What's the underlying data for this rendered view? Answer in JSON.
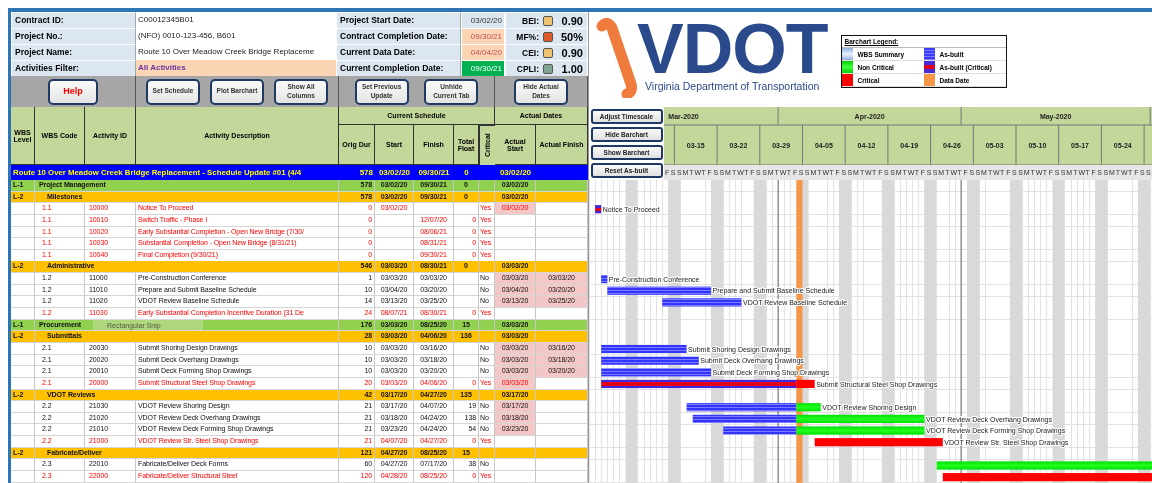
{
  "info_rows": [
    {
      "label": "Contract ID:",
      "value": {
        "text": "C00012345B01",
        "kind": "text"
      },
      "date_label": "Project Start Date:",
      "date": {
        "text": "03/02/20",
        "kind": "plain"
      },
      "metric": "BEI:",
      "metric_value": "0.90",
      "color": "#f2c46d"
    },
    {
      "label": "Project No.:",
      "value": {
        "text": "(NFO) 0010-123-456, B601",
        "kind": "text"
      },
      "date_label": "Contract Completion Date:",
      "date": {
        "text": "09/30/21",
        "kind": "flag"
      },
      "metric": "MF%:",
      "metric_value": "50%",
      "color": "#e0592a"
    },
    {
      "label": "Project Name:",
      "value": {
        "text": "Route 10 Over Meadow Creek Bridge Replaceme",
        "kind": "text"
      },
      "date_label": "Current Data Date:",
      "date": {
        "text": "04/04/20",
        "kind": "flag"
      },
      "metric": "CEI:",
      "metric_value": "0.90",
      "color": "#f2c46d"
    },
    {
      "label": "Activities Filter:",
      "value": {
        "text": "All Activities",
        "kind": "filter"
      },
      "date_label": "Current Completion Date:",
      "date": {
        "text": "09/30/21",
        "kind": "good"
      },
      "metric": "CPLI:",
      "metric_value": "1.00",
      "color": "#7fa58e"
    }
  ],
  "toolbar": [
    [
      {
        "label": "Help",
        "kind": "help"
      }
    ],
    [
      {
        "label": "Set Schedule",
        "kind": "normal"
      },
      {
        "label": "Plot Barchart",
        "kind": "normal"
      },
      {
        "label": "Show All Columns",
        "kind": "normal"
      }
    ],
    [
      {
        "label": "Set Previous Update",
        "kind": "normal"
      },
      {
        "label": "Unhide Current Tab",
        "kind": "normal"
      }
    ],
    [
      {
        "label": "Hide Actual Dates",
        "kind": "normal"
      }
    ]
  ],
  "header": {
    "columns": [
      "WBS Level",
      "WBS Code",
      "Activity ID",
      "Activity Description",
      "Orig Dur",
      "Start",
      "Finish",
      "Total Float",
      "Critical",
      "Actual Start",
      "Actual Finish"
    ],
    "groups": [
      "Current Schedule",
      "Actual Dates"
    ]
  },
  "title_row": {
    "text": "Route 10 Over Meadow Creek Bridge Replacement - Schedule Update #01 (4/4",
    "orig_dur": "578",
    "start": "03/02/20",
    "finish": "09/30/21",
    "total_float": "0",
    "actual_start": "03/02/20"
  },
  "rows": [
    {
      "kind": "l1",
      "level": "L-1",
      "name": "Project Management",
      "orig_dur": "578",
      "start": "03/02/20",
      "finish": "09/30/21",
      "total_float": "0",
      "actual_start": "03/02/20"
    },
    {
      "kind": "l2",
      "level": "L-2",
      "name": "Milestones",
      "orig_dur": "578",
      "start": "03/02/20",
      "finish": "09/30/21",
      "total_float": "0",
      "actual_start": "03/02/20"
    },
    {
      "kind": "activity",
      "code": "1.1",
      "id": "10000",
      "description": "Notice To Proceed",
      "orig_dur": "0",
      "start": "03/02/20",
      "critical_text": "Yes",
      "critical": true,
      "actual_start": "03/02/20",
      "bar_label": "Notice To Proceed"
    },
    {
      "kind": "activity",
      "code": "1.1",
      "id": "10010",
      "description": "Switch Traffic - Phase I",
      "orig_dur": "0",
      "finish": "12/07/20",
      "total_float": "0",
      "critical_text": "Yes",
      "critical": true
    },
    {
      "kind": "activity",
      "code": "1.1",
      "id": "10020",
      "description": "Early Substantial Completion - Open New Bridge (7/30/",
      "orig_dur": "0",
      "finish": "08/06/21",
      "total_float": "0",
      "critical_text": "Yes",
      "critical": true
    },
    {
      "kind": "activity",
      "code": "1.1",
      "id": "10030",
      "description": "Substantial Completion - Open New Bridge (8/31/21)",
      "orig_dur": "0",
      "finish": "08/31/21",
      "total_float": "0",
      "critical_text": "Yes",
      "critical": true
    },
    {
      "kind": "activity",
      "code": "1.1",
      "id": "10040",
      "description": "Final Completion (9/30/21)",
      "orig_dur": "0",
      "finish": "09/30/21",
      "total_float": "0",
      "critical_text": "Yes",
      "critical": true
    },
    {
      "kind": "l2",
      "level": "L-2",
      "name": "Administrative",
      "orig_dur": "546",
      "start": "03/03/20",
      "finish": "08/30/21",
      "total_float": "0",
      "actual_start": "03/03/20"
    },
    {
      "kind": "activity",
      "code": "1.2",
      "id": "11000",
      "description": "Pre-Construction Conference",
      "orig_dur": "1",
      "start": "03/03/20",
      "finish": "03/03/20",
      "critical_text": "No",
      "critical": false,
      "actual_start": "03/03/20",
      "actual_finish": "03/03/20",
      "bar_label": "Pre-Construction Conference"
    },
    {
      "kind": "activity",
      "code": "1.2",
      "id": "11010",
      "description": "Prepare and Submit Baseline Schedule",
      "orig_dur": "10",
      "start": "03/04/20",
      "finish": "03/20/20",
      "critical_text": "No",
      "critical": false,
      "actual_start": "03/04/20",
      "actual_finish": "03/20/20",
      "bar_label": "Prepare and Submit Baseline Schedule"
    },
    {
      "kind": "activity",
      "code": "1.2",
      "id": "11020",
      "description": "VDOT Review Baseline Schedule",
      "orig_dur": "14",
      "start": "03/13/20",
      "finish": "03/25/20",
      "critical_text": "No",
      "critical": false,
      "actual_start": "03/13/20",
      "actual_finish": "03/25/20",
      "bar_label": "VDOT Review Baseline Schedule"
    },
    {
      "kind": "activity",
      "code": "1.2",
      "id": "11030",
      "description": "Early Substantial Completion Incentive Duration (31 De",
      "orig_dur": "24",
      "start": "08/07/21",
      "finish": "08/30/21",
      "total_float": "0",
      "critical_text": "Yes",
      "critical": true
    },
    {
      "kind": "l1",
      "level": "L-1",
      "name": "Procurement",
      "orig_dur": "176",
      "start": "03/03/20",
      "finish": "08/25/20",
      "total_float": "15",
      "actual_start": "03/03/20"
    },
    {
      "kind": "l2",
      "level": "L-2",
      "name": "Submittals",
      "orig_dur": "28",
      "start": "03/03/20",
      "finish": "04/06/20",
      "total_float": "136",
      "actual_start": "03/03/20"
    },
    {
      "kind": "activity",
      "code": "2.1",
      "id": "20030",
      "description": "Submit Shoring Design Drawings",
      "orig_dur": "10",
      "start": "03/03/20",
      "finish": "03/16/20",
      "critical_text": "No",
      "critical": false,
      "actual_start": "03/03/20",
      "actual_finish": "03/16/20",
      "bar_label": "Submit Shoring Design Drawings"
    },
    {
      "kind": "activity",
      "code": "2.1",
      "id": "20020",
      "description": "Submit Deck Overhang Drawings",
      "orig_dur": "10",
      "start": "03/03/20",
      "finish": "03/18/20",
      "critical_text": "No",
      "critical": false,
      "actual_start": "03/03/20",
      "actual_finish": "03/18/20",
      "bar_label": "Submit Deck Overhang Drawings"
    },
    {
      "kind": "activity",
      "code": "2.1",
      "id": "20010",
      "description": "Submit Deck Forming Shop Drawings",
      "orig_dur": "10",
      "start": "03/03/20",
      "finish": "03/20/20",
      "critical_text": "No",
      "critical": false,
      "actual_start": "03/03/20",
      "actual_finish": "03/20/20",
      "bar_label": "Submit Deck Forming Shop Drawings"
    },
    {
      "kind": "activity",
      "code": "2.1",
      "id": "20000",
      "description": "Submit Structural Steel Shop Drawings",
      "orig_dur": "20",
      "start": "03/03/20",
      "finish": "04/06/20",
      "total_float": "0",
      "critical_text": "Yes",
      "critical": true,
      "actual_start": "03/03/20",
      "bar_label": "Submit Structural Steel Shop Drawings"
    },
    {
      "kind": "l2",
      "level": "L-2",
      "name": "VDOT Reviews",
      "orig_dur": "42",
      "start": "03/17/20",
      "finish": "04/27/20",
      "total_float": "135",
      "actual_start": "03/17/20"
    },
    {
      "kind": "activity",
      "code": "2.2",
      "id": "21030",
      "description": "VDOT Review Shoring Design",
      "orig_dur": "21",
      "start": "03/17/20",
      "finish": "04/07/20",
      "total_float": "19",
      "critical_text": "No",
      "critical": false,
      "actual_start": "03/17/20",
      "bar_label": "VDOT Review Shoring Design"
    },
    {
      "kind": "activity",
      "code": "2.2",
      "id": "21020",
      "description": "VDOT Review Deck Overhang Drawings",
      "orig_dur": "21",
      "start": "03/18/20",
      "finish": "04/24/20",
      "total_float": "138",
      "critical_text": "No",
      "critical": false,
      "actual_start": "03/18/20",
      "bar_label": "VDOT Review Deck Overhang Drawings"
    },
    {
      "kind": "activity",
      "code": "2.2",
      "id": "21010",
      "description": "VDOT Review Deck Forming Shop Drawings",
      "orig_dur": "21",
      "start": "03/23/20",
      "finish": "04/24/20",
      "total_float": "54",
      "critical_text": "No",
      "critical": false,
      "actual_start": "03/23/20",
      "bar_label": "VDOT Review Deck Forming Shop Drawings"
    },
    {
      "kind": "activity",
      "code": "2.2",
      "id": "21000",
      "description": "VDOT Review Str. Steel Shop Drawings",
      "orig_dur": "21",
      "start": "04/07/20",
      "finish": "04/27/20",
      "total_float": "0",
      "critical_text": "Yes",
      "critical": true,
      "bar_label": "VDOT Review Str. Steel Shop Drawings"
    },
    {
      "kind": "l2",
      "level": "L-2",
      "name": "Fabricate/Deliver",
      "orig_dur": "121",
      "start": "04/27/20",
      "finish": "08/25/20",
      "total_float": "15"
    },
    {
      "kind": "activity",
      "code": "2.3",
      "id": "22010",
      "description": "Fabricate/Deliver Deck Forms",
      "orig_dur": "60",
      "start": "04/27/20",
      "finish": "07/17/20",
      "total_float": "38",
      "critical_text": "No",
      "critical": false
    },
    {
      "kind": "activity",
      "code": "2.3",
      "id": "22000",
      "description": "Fabricate/Deliver Structural Steel",
      "orig_dur": "120",
      "start": "04/28/20",
      "finish": "08/25/20",
      "total_float": "0",
      "critical_text": "Yes",
      "critical": true
    }
  ],
  "snip_tooltip": {
    "text": "Rectangular Snip"
  },
  "logo": {
    "text": "VDOT",
    "subtitle": "Virginia Department of Transportation"
  },
  "legend": {
    "title": "Barchart Legend:",
    "items": [
      {
        "label": "WBS Summary",
        "kind": "summary"
      },
      {
        "label": "As-built",
        "kind": "asbuilt"
      },
      {
        "label": "Non Critical",
        "kind": "noncritical"
      },
      {
        "label": "As-built (Critical)",
        "kind": "asbuilt-critical"
      },
      {
        "label": "Critical",
        "kind": "critical"
      },
      {
        "label": "Data Date",
        "kind": "datadate"
      }
    ]
  },
  "gantt_buttons": [
    "Adjust Timescale",
    "Hide Barchart",
    "Show Barchart",
    "Reset As-built"
  ],
  "timeline": {
    "months": [
      "Mar-2020",
      "Apr-2020",
      "May-2020"
    ],
    "weeks": [
      "03-15",
      "03-22",
      "03-29",
      "04-05",
      "04-12",
      "04-19",
      "04-26",
      "05-03",
      "05-10",
      "05-17",
      "05-24"
    ],
    "day_letters": [
      "F",
      "S",
      "S",
      "M",
      "T",
      "W",
      "T",
      "F",
      "S",
      "S",
      "M",
      "T",
      "W",
      "T",
      "F",
      "S",
      "S",
      "M",
      "T",
      "W",
      "T",
      "F",
      "S",
      "S",
      "M",
      "T",
      "W",
      "T",
      "F",
      "S",
      "S",
      "M",
      "T",
      "W",
      "T",
      "F",
      "S",
      "S",
      "M",
      "T",
      "W",
      "T",
      "F",
      "S",
      "S",
      "M",
      "T",
      "W",
      "T",
      "F",
      "S",
      "S",
      "M",
      "T",
      "W",
      "T",
      "F",
      "S",
      "S",
      "M",
      "T",
      "W",
      "T",
      "F",
      "S",
      "S",
      "M",
      "T",
      "W",
      "T",
      "F",
      "S",
      "S",
      "M",
      "T",
      "W",
      "T",
      "F",
      "S",
      "S"
    ]
  }
}
